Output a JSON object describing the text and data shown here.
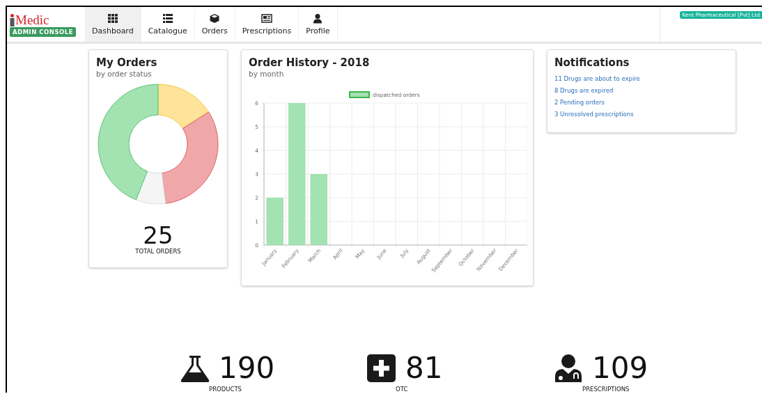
{
  "logo": {
    "name": "Medic",
    "tagline": "ADMIN CONSOLE"
  },
  "nav_tabs": [
    {
      "label": "Dashboard",
      "selected": true
    },
    {
      "label": "Catalogue",
      "selected": false
    },
    {
      "label": "Orders",
      "selected": false
    },
    {
      "label": "Prescriptions",
      "selected": false
    },
    {
      "label": "Profile",
      "selected": false
    }
  ],
  "account_badge": "Kent Pharmaceutical [Pvt] Ltd",
  "my_orders": {
    "title": "My Orders",
    "subtitle": "by order status",
    "total": "25",
    "total_label": "TOTAL ORDERS"
  },
  "order_history": {
    "title": "Order History - 2018",
    "subtitle": "by month",
    "chart_data": {
      "type": "bar",
      "categories": [
        "January",
        "February",
        "March",
        "April",
        "May",
        "June",
        "July",
        "August",
        "September",
        "October",
        "November",
        "December"
      ],
      "series": [
        {
          "name": "dispatched orders",
          "color": "#a3e2b1",
          "values": [
            2,
            6,
            3,
            0,
            0,
            0,
            0,
            0,
            0,
            0,
            0,
            0
          ]
        }
      ],
      "ylim": [
        0,
        6
      ],
      "yticks": [
        0,
        1,
        2,
        3,
        4,
        5,
        6
      ],
      "grid": true
    }
  },
  "notifications": {
    "title": "Notifications",
    "items": [
      "11 Drugs are about to expire",
      "8 Drugs are expired",
      "2 Pending orders",
      "3 Unresolved prescriptions"
    ]
  },
  "stats": [
    {
      "value": "190",
      "label": "PRODUCTS"
    },
    {
      "value": "81",
      "label": "OTC"
    },
    {
      "value": "109",
      "label": "PRESCRIPTIONS"
    }
  ]
}
